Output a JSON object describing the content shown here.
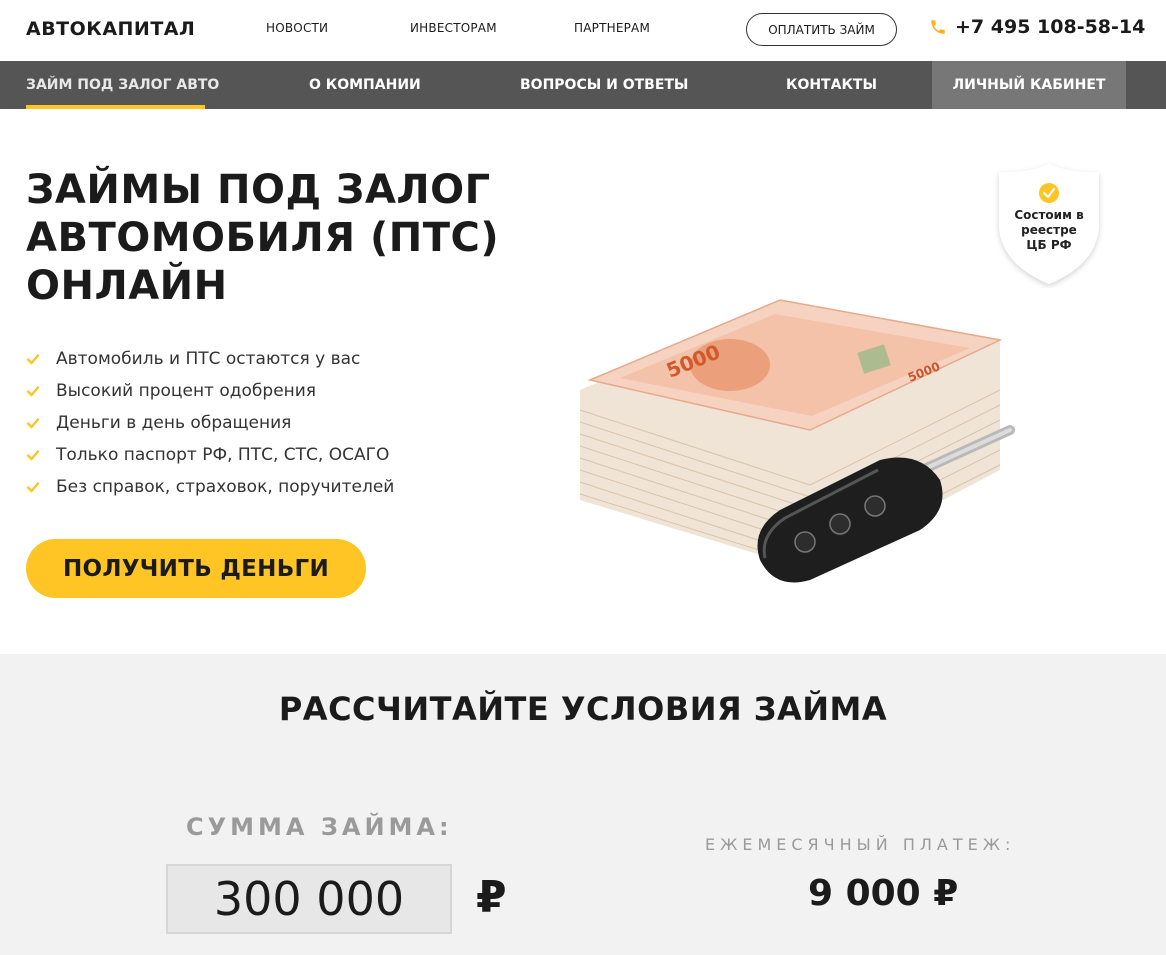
{
  "brand": {
    "logo": "АВТОКАПИТАЛ"
  },
  "topnav": {
    "links": [
      "НОВОСТИ",
      "ИНВЕСТОРАМ",
      "ПАРТНЕРАМ"
    ],
    "pay_button": "ОПЛАТИТЬ ЗАЙМ",
    "phone": "+7 495 108-58-14"
  },
  "mainnav": {
    "items": [
      "ЗАЙМ ПОД ЗАЛОГ АВТО",
      "О КОМПАНИИ",
      "ВОПРОСЫ И ОТВЕТЫ",
      "КОНТАКТЫ"
    ],
    "cabinet": "ЛИЧНЫЙ КАБИНЕТ"
  },
  "hero": {
    "title_lines": [
      "ЗАЙМЫ ПОД ЗАЛОГ",
      "АВТОМОБИЛЯ (ПТС)",
      "ОНЛАЙН"
    ],
    "benefits": [
      "Автомобиль и ПТС остаются у вас",
      "Высокий процент одобрения",
      "Деньги в день обращения",
      "Только паспорт РФ, ПТС, СТС, ОСАГО",
      "Без справок, страховок, поручителей"
    ],
    "cta": "ПОЛУЧИТЬ ДЕНЬГИ",
    "badge_lines": [
      "Состоим в",
      "реестре",
      "ЦБ РФ"
    ]
  },
  "calculator": {
    "title": "РАССЧИТАЙТЕ УСЛОВИЯ ЗАЙМА",
    "sum_label": "СУММА ЗАЙМА:",
    "sum_value": "300 000",
    "currency": "₽",
    "payment_label": "ЕЖЕМЕСЯЧНЫЙ ПЛАТЕЖ:",
    "payment_value": "9 000 ₽"
  },
  "colors": {
    "accent": "#ffc524",
    "nav_bg": "#555555",
    "cabinet_bg": "#777777",
    "calc_bg": "#f2f2f2"
  },
  "icons": [
    "phone-icon",
    "check-icon",
    "shield-badge-icon",
    "money-and-key-image"
  ]
}
